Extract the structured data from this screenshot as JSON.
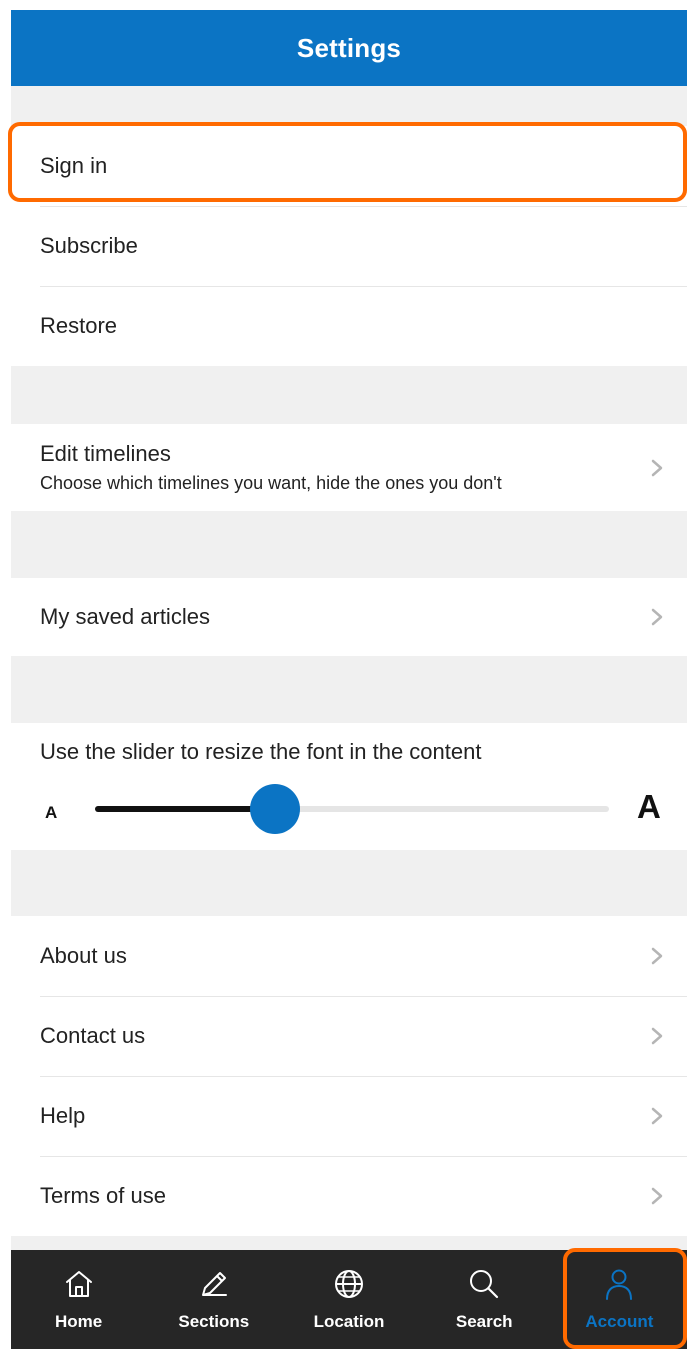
{
  "header": {
    "title": "Settings"
  },
  "account_items": [
    {
      "label": "Sign in"
    },
    {
      "label": "Subscribe"
    },
    {
      "label": "Restore"
    }
  ],
  "timelines": {
    "title": "Edit timelines",
    "caption": "Choose which timelines you want, hide the ones you don't"
  },
  "saved": {
    "label": "My saved articles"
  },
  "font_size": {
    "caption": "Use the slider to resize the font in the content",
    "small_label": "A",
    "large_label": "A",
    "value": 0.35
  },
  "info_items": [
    {
      "label": "About us"
    },
    {
      "label": "Contact us"
    },
    {
      "label": "Help"
    },
    {
      "label": "Terms of use"
    }
  ],
  "tabs": [
    {
      "label": "Home",
      "icon": "home-icon"
    },
    {
      "label": "Sections",
      "icon": "pencil-icon"
    },
    {
      "label": "Location",
      "icon": "globe-icon"
    },
    {
      "label": "Search",
      "icon": "search-icon"
    },
    {
      "label": "Account",
      "icon": "person-icon",
      "active": true
    }
  ],
  "colors": {
    "accent": "#0b74c4",
    "highlight": "#ff6a00",
    "tabbar": "#262626"
  }
}
